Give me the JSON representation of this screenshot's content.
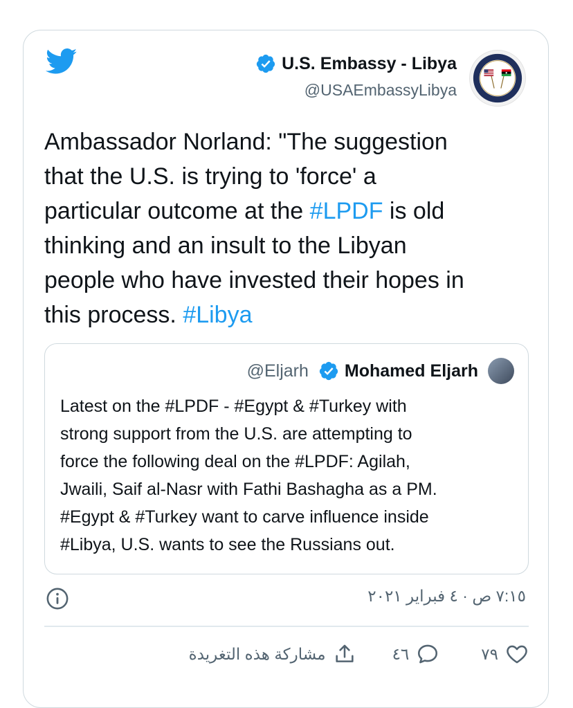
{
  "author": {
    "name": "U.S. Embassy - Libya",
    "handle": "@USAEmbassyLibya"
  },
  "tweet": {
    "line1": "Ambassador Norland: \"The suggestion",
    "line2": "that the U.S. is trying to 'force' a",
    "line3a": "particular outcome at the ",
    "tag1": "#LPDF",
    "line3b": " is old",
    "line4": "thinking and an insult to the Libyan",
    "line5": "people who have invested their hopes in",
    "line6a": "this process. ",
    "tag2": "#Libya"
  },
  "quoted": {
    "name": "Mohamed Eljarh",
    "handle": "@Eljarh",
    "lines": [
      "Latest on the #LPDF - #Egypt & #Turkey with",
      "strong support from the U.S. are attempting to",
      "force the following deal on the #LPDF: Agilah,",
      "Jwaili, Saif al-Nasr with Fathi Bashagha as a PM.",
      "#Egypt & #Turkey want to carve influence inside",
      "#Libya, U.S. wants to see the Russians out."
    ]
  },
  "timestamp": "٧:١٥ ص · ٤ فبراير ٢٠٢١",
  "actions": {
    "like_count": "٧٩",
    "reply_count": "٤٦",
    "share_label": "مشاركة هذه التغريدة"
  },
  "icons": {
    "logo": "twitter-bird-icon",
    "verified": "verified-badge-icon",
    "info": "info-icon",
    "like": "heart-icon",
    "reply": "reply-bubble-icon",
    "share": "share-icon"
  },
  "colors": {
    "accent": "#1d9bf0",
    "text": "#0f1419",
    "secondary": "#536471",
    "border": "#cfd9de"
  }
}
